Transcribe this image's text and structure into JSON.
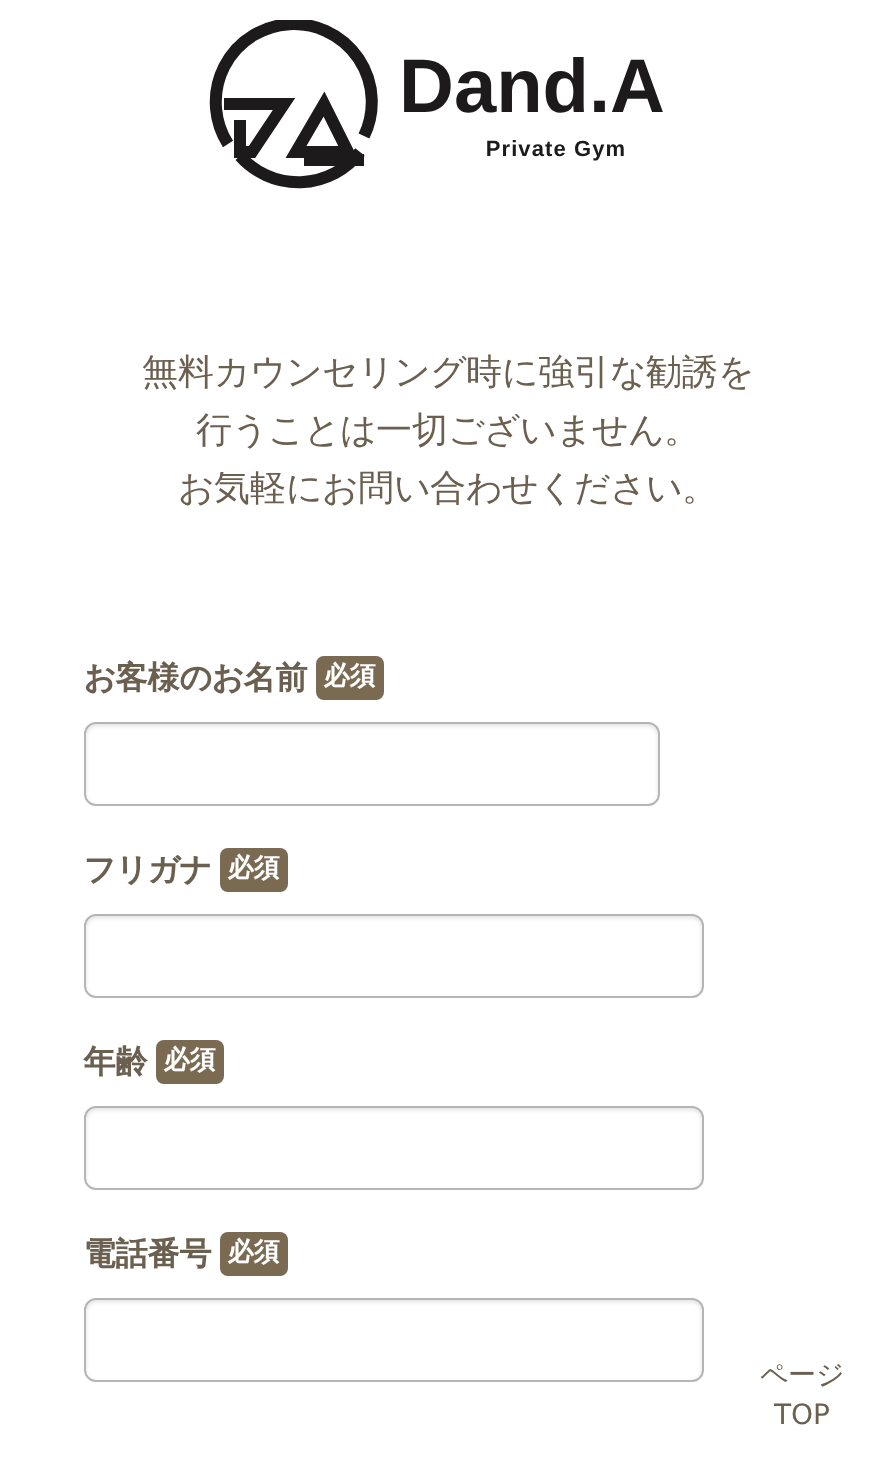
{
  "logo": {
    "name": "Dand.A",
    "tagline": "Private Gym"
  },
  "intro": [
    "無料カウンセリング時に強引な勧誘を",
    "行うことは一切ございません。",
    "お気軽にお問い合わせください。"
  ],
  "fields": [
    {
      "label": "お客様のお名前",
      "badge": "必須",
      "kind": "short"
    },
    {
      "label": "フリガナ",
      "badge": "必須",
      "kind": "standard"
    },
    {
      "label": "年齢",
      "badge": "必須",
      "kind": "standard"
    },
    {
      "label": "電話番号",
      "badge": "必須",
      "kind": "standard"
    }
  ],
  "page_top": {
    "lines": [
      "ページ",
      "TOP"
    ]
  }
}
